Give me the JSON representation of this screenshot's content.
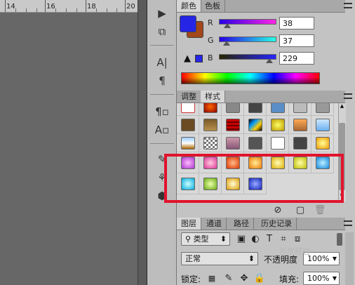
{
  "ruler": {
    "ticks": [
      "14",
      "16",
      "18",
      "20"
    ]
  },
  "color_panel": {
    "tabs": [
      "颜色",
      "色板"
    ],
    "channels": [
      {
        "label": "R",
        "value": "38",
        "level": 0.15
      },
      {
        "label": "G",
        "value": "37",
        "level": 0.15
      },
      {
        "label": "B",
        "value": "229",
        "level": 0.9
      }
    ],
    "foreground": "#2625e5",
    "background": "#a3461a"
  },
  "styles_panel": {
    "tabs": [
      "调整",
      "样式"
    ],
    "highlight_color": "#e1132d"
  },
  "layers_panel": {
    "tabs": [
      "图层",
      "通道",
      "路径",
      "历史记录"
    ],
    "filter_type": "类型",
    "blend_mode": "正常",
    "opacity_label": "不透明度",
    "opacity_value": "100%",
    "lock_label": "锁定:",
    "fill_label": "填充:",
    "fill_value": "100%"
  },
  "watermark": "百度经验"
}
